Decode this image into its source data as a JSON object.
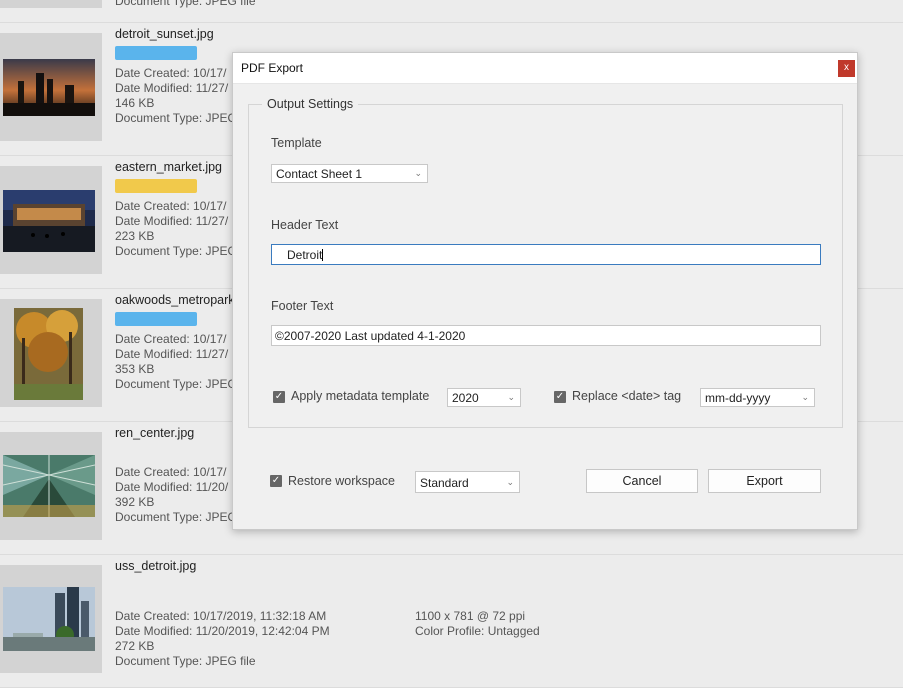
{
  "files": [
    {
      "name": "",
      "created": "",
      "modified": "",
      "size": "",
      "type": "Document Type: JPEG file",
      "tag_color": ""
    },
    {
      "name": "detroit_sunset.jpg",
      "created": "Date Created: 10/17/",
      "modified": "Date Modified: 11/27/",
      "size": "146 KB",
      "type": "Document Type: JPEG",
      "tag_color": "#5ab4ec",
      "thumb": "sunset"
    },
    {
      "name": "eastern_market.jpg",
      "created": "Date Created: 10/17/",
      "modified": "Date Modified: 11/27/",
      "size": "223 KB",
      "type": "Document Type: JPEG",
      "tag_color": "#f1c94b",
      "thumb": "market"
    },
    {
      "name": "oakwoods_metropark",
      "created": "Date Created: 10/17/",
      "modified": "Date Modified: 11/27/",
      "size": "353 KB",
      "type": "Document Type: JPEG",
      "tag_color": "#5ab4ec",
      "thumb": "forest"
    },
    {
      "name": "ren_center.jpg",
      "created": "Date Created: 10/17/",
      "modified": "Date Modified: 11/20/",
      "size": "392 KB",
      "type": "Document Type: JPEG file",
      "tag_color": "",
      "thumb": "glass"
    },
    {
      "name": "uss_detroit.jpg",
      "created": "Date Created: 10/17/2019, 11:32:18 AM",
      "modified": "Date Modified: 11/20/2019, 12:42:04 PM",
      "size": "272 KB",
      "type": "Document Type: JPEG file",
      "tag_color": "",
      "dims": "1100 x 781 @ 72 ppi",
      "profile": "Color Profile: Untagged",
      "thumb": "harbor"
    }
  ],
  "dialog": {
    "title": "PDF Export",
    "close_label": "x",
    "group_legend": "Output Settings",
    "template_label": "Template",
    "template_value": "Contact Sheet 1",
    "header_label": "Header Text",
    "header_value": "Detroit",
    "footer_label": "Footer Text",
    "footer_value": "©2007-2020  Last updated 4-1-2020",
    "apply_metadata_label": "Apply metadata template",
    "apply_metadata_checked": true,
    "metadata_value": "2020",
    "replace_date_label": "Replace <date> tag",
    "replace_date_checked": true,
    "date_format_value": "mm-dd-yyyy",
    "restore_label": "Restore workspace",
    "restore_checked": true,
    "workspace_value": "Standard",
    "cancel_label": "Cancel",
    "export_label": "Export"
  }
}
